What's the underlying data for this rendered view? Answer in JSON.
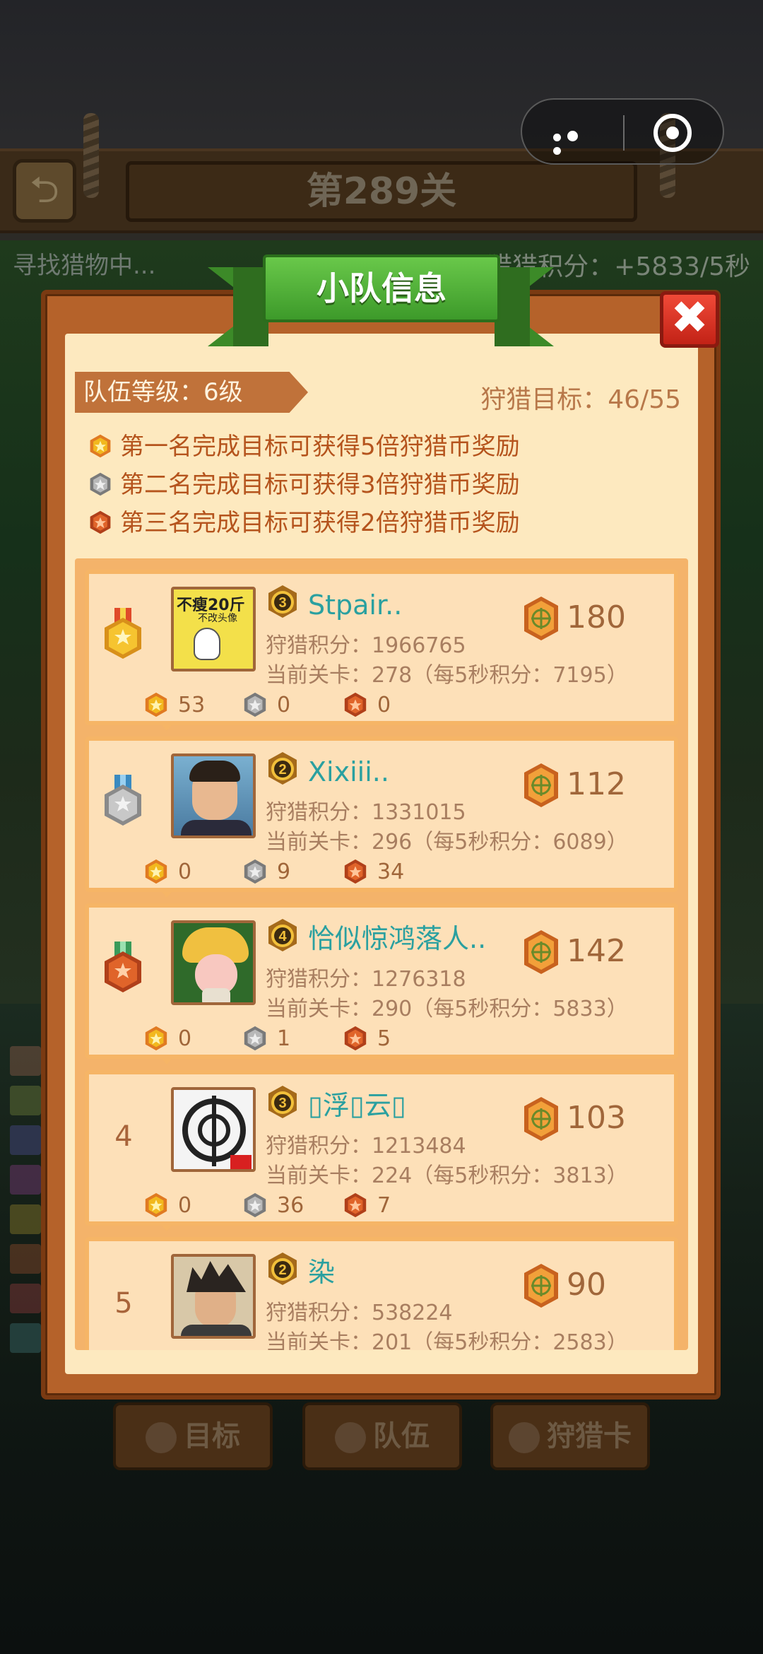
{
  "background": {
    "level_title": "第289关",
    "status_left": "寻找猎物中...",
    "status_right": "猎猎积分：+5833/5秒",
    "tabs": [
      "目标",
      "队伍",
      "狩猎卡"
    ]
  },
  "dialog": {
    "title": "小队信息",
    "close_label": "✖",
    "team_level": "队伍等级：6级",
    "hunt_target": "狩猎目标：46/55",
    "rules": [
      {
        "text": "第一名完成目标可获得5倍狩猎币奖励",
        "medal": "gold"
      },
      {
        "text": "第二名完成目标可获得3倍狩猎币奖励",
        "medal": "silver"
      },
      {
        "text": "第三名完成目标可获得2倍狩猎币奖励",
        "medal": "bronze"
      }
    ]
  },
  "members": [
    {
      "rank": "1",
      "rank_medal": "gold",
      "level": "3",
      "name": "Stpair..",
      "score": "狩猎积分：1966765",
      "stage": "当前关卡：278（每5秒积分：7195）",
      "coins": "180",
      "gold": "53",
      "silver": "0",
      "bronze": "0",
      "avatar_caption": "不瘦20斤",
      "avatar_caption2": "不改头像"
    },
    {
      "rank": "2",
      "rank_medal": "silver",
      "level": "2",
      "name": "Xixiii..",
      "score": "狩猎积分：1331015",
      "stage": "当前关卡：296（每5秒积分：6089）",
      "coins": "112",
      "gold": "0",
      "silver": "9",
      "bronze": "34"
    },
    {
      "rank": "3",
      "rank_medal": "bronze",
      "level": "4",
      "name": "恰似惊鸿落人..",
      "score": "狩猎积分：1276318",
      "stage": "当前关卡：290（每5秒积分：5833）",
      "coins": "142",
      "gold": "0",
      "silver": "1",
      "bronze": "5"
    },
    {
      "rank": "4",
      "rank_medal": "",
      "level": "3",
      "name": "▯浮▯云▯",
      "score": "狩猎积分：1213484",
      "stage": "当前关卡：224（每5秒积分：3813）",
      "coins": "103",
      "gold": "0",
      "silver": "36",
      "bronze": "7"
    },
    {
      "rank": "5",
      "rank_medal": "",
      "level": "2",
      "name": "染",
      "score": "狩猎积分：538224",
      "stage": "当前关卡：201（每5秒积分：2583）",
      "coins": "90",
      "gold": "",
      "silver": "",
      "bronze": ""
    }
  ],
  "colors": {
    "gold": "#f2b81e",
    "silver": "#a9a9a9",
    "bronze": "#e0642a",
    "accent_green": "#4caf34",
    "name_teal": "#2aa0a0"
  }
}
